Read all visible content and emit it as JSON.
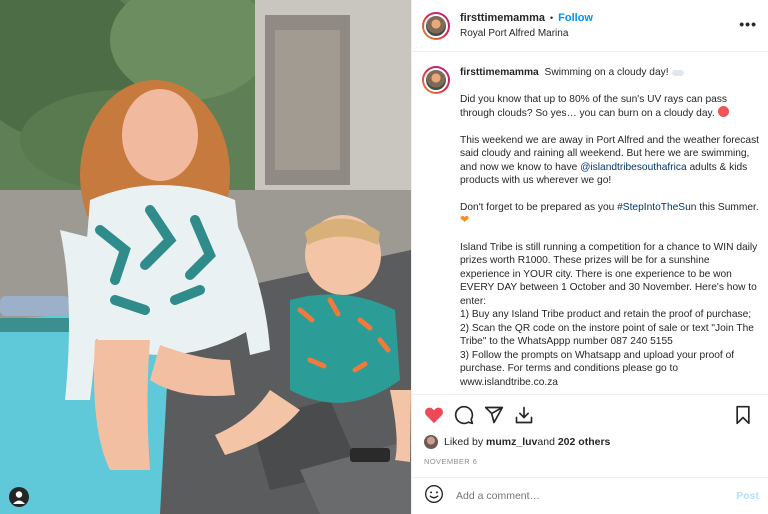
{
  "post": {
    "username": "firsttimemamma",
    "follow_label": "Follow",
    "separator": "•",
    "location": "Royal Port Alfred Marina",
    "more_label": "•••"
  },
  "caption": {
    "username": "firsttimemamma",
    "line1": "Swimming on a cloudy day!",
    "p1": "Did you know that up to 80% of the sun's UV rays can pass through clouds? So yes… you can burn on a cloudy day.",
    "p2_a": "This weekend we are away in Port Alfred and the weather forecast said cloudy and raining all weekend. But here we are swimming, and now we know to have ",
    "p2_tag": "@islandtribesouthafrica",
    "p2_b": " adults & kids products with us wherever we go!",
    "p3_a": "Don't forget to be prepared as you ",
    "p3_hashtag": "#StepIntoTheSun",
    "p3_b": " this Summer.",
    "p4_intro": "Island Tribe is still running a competition for a chance to WIN daily prizes worth R1000. These prizes will be for a sunshine experience in YOUR city. There is one experience to be won EVERY DAY between 1 October and 30 November. Here's how to enter:",
    "p4_step1": "1) Buy any Island Tribe product and retain the proof of purchase;",
    "p4_step2": "2) Scan the QR code on the instore point of sale or text \"Join The Tribe\" to the WhatsAppp number 087 240 5155",
    "p4_step3": "3) Follow the prompts on Whatsapp and upload your proof of purchase. For terms and conditions please go to www.islandtribe.co.za"
  },
  "icons": {
    "like": "heart-icon",
    "comment": "comment-icon",
    "share": "send-icon",
    "save_to": "download-icon",
    "bookmark": "bookmark-icon",
    "emoji": "smiley-icon",
    "photo_user": "user-tag-icon"
  },
  "colors": {
    "like_heart": "#ed4956",
    "link": "#00376b",
    "follow": "#0095f6",
    "post_disabled": "#b2dffc"
  },
  "likes": {
    "prefix": "Liked by ",
    "user": "mumz_luv",
    "middle": " and ",
    "count": "202 others"
  },
  "date": "NOVEMBER 6",
  "comment": {
    "placeholder": "Add a comment…",
    "post_label": "Post"
  }
}
